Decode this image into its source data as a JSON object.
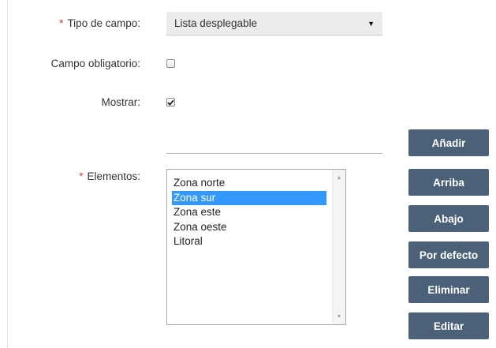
{
  "form": {
    "field_type": {
      "required_mark": "*",
      "label": "Tipo de campo:",
      "value": "Lista desplegable"
    },
    "required_field": {
      "label": "Campo obligatorio:",
      "checked": false
    },
    "show": {
      "label": "Mostrar:",
      "checked": true
    },
    "new_element_input": {
      "value": ""
    },
    "elements": {
      "required_mark": "*",
      "label": "Elementos:",
      "items": [
        "Zona norte",
        "Zona sur",
        "Zona este",
        "Zona oeste",
        "Litoral"
      ],
      "selected": "Zona sur"
    }
  },
  "buttons": {
    "add": "Añadir",
    "up": "Arriba",
    "down": "Abajo",
    "default": "Por defecto",
    "delete": "Eliminar",
    "edit": "Editar"
  },
  "icons": {
    "dropdown": "caret-down-icon",
    "scroll_up": "scroll-up-icon",
    "scroll_down": "scroll-down-icon",
    "checkmark": "checkmark-icon"
  },
  "colors": {
    "required": "#d9343a",
    "button_bg": "#4a6177",
    "selection": "#3399ff"
  }
}
